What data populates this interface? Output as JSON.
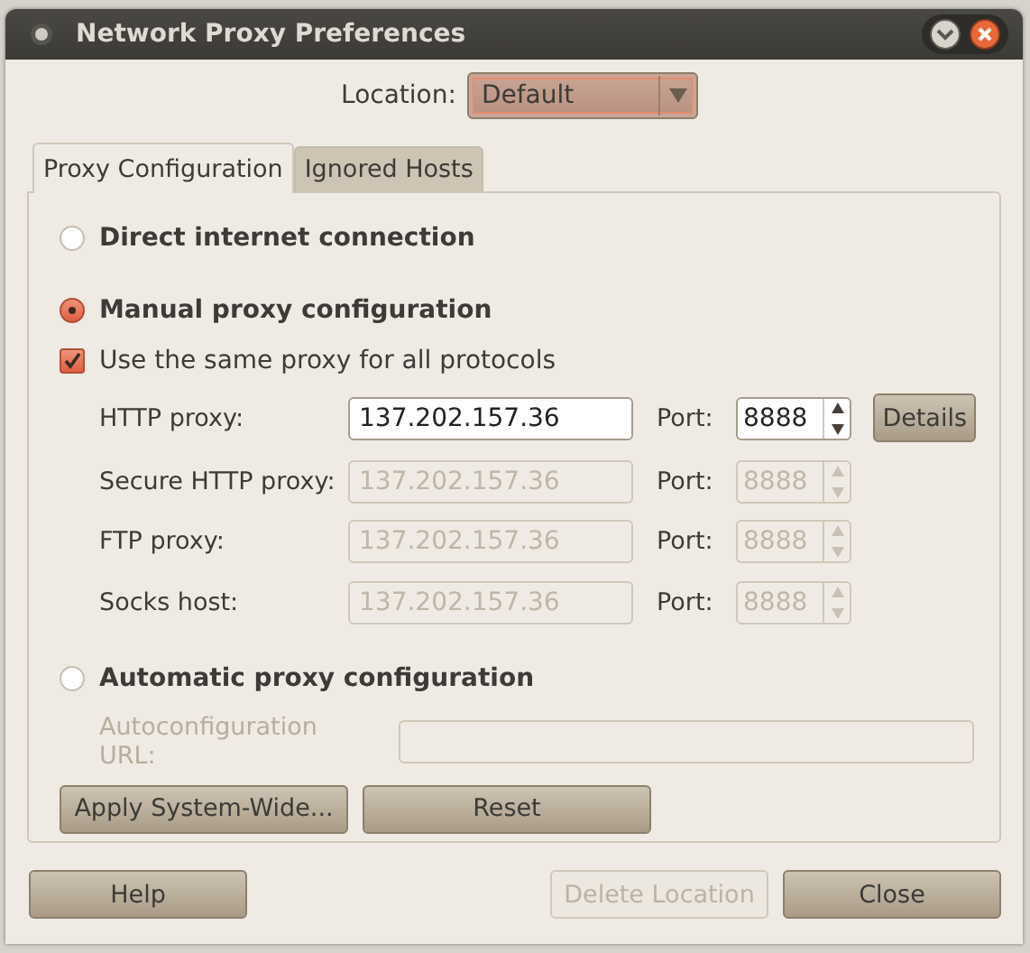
{
  "window": {
    "title": "Network Proxy Preferences"
  },
  "location": {
    "label": "Location:",
    "value": "Default"
  },
  "tabs": [
    {
      "label": "Proxy Configuration",
      "selected": true
    },
    {
      "label": "Ignored Hosts",
      "selected": false
    }
  ],
  "modes": [
    {
      "label": "Direct internet connection",
      "selected": false
    },
    {
      "label": "Manual proxy configuration",
      "selected": true
    },
    {
      "label": "Automatic proxy configuration",
      "selected": false
    }
  ],
  "same_proxy": {
    "label": "Use the same proxy for all protocols",
    "checked": true
  },
  "proxies": [
    {
      "label": "HTTP proxy:",
      "host": "137.202.157.36",
      "port_label": "Port:",
      "port": "8888",
      "disabled": false,
      "details": "Details"
    },
    {
      "label": "Secure HTTP proxy:",
      "host": "137.202.157.36",
      "port_label": "Port:",
      "port": "8888",
      "disabled": true
    },
    {
      "label": "FTP proxy:",
      "host": "137.202.157.36",
      "port_label": "Port:",
      "port": "8888",
      "disabled": true
    },
    {
      "label": "Socks host:",
      "host": "137.202.157.36",
      "port_label": "Port:",
      "port": "8888",
      "disabled": true
    }
  ],
  "autoconfig": {
    "label": "Autoconfiguration URL:",
    "disabled": true
  },
  "panel_buttons": [
    {
      "label": "Apply System-Wide...",
      "disabled": false
    },
    {
      "label": "Reset",
      "disabled": false
    }
  ],
  "dialog_buttons": [
    {
      "label": "Help",
      "disabled": false
    },
    {
      "label": "Delete Location",
      "disabled": true
    },
    {
      "label": "Close",
      "disabled": false
    }
  ]
}
